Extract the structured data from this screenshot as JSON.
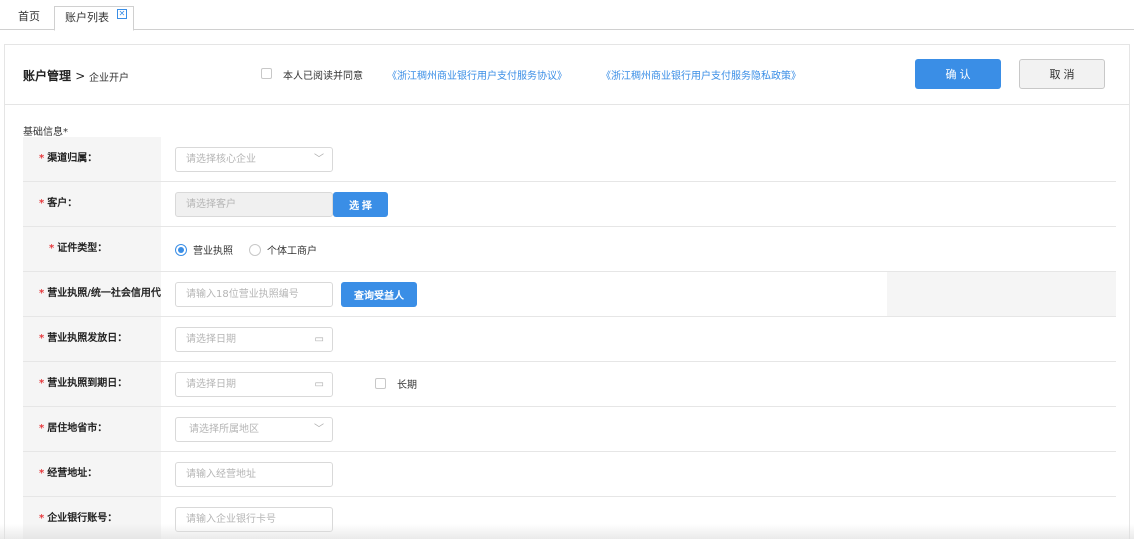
{
  "tabs": {
    "home": "首页",
    "active": "账户列表"
  },
  "header": {
    "crumb_main": "账户管理",
    "crumb_sep": ">",
    "crumb_sub": "企业开户",
    "agree_text": "本人已阅读并同意",
    "link1": "《浙江稠州商业银行用户支付服务协议》",
    "link2": "《浙江稠州商业银行用户支付服务隐私政策》",
    "confirm": "确 认",
    "cancel": "取 消"
  },
  "form": {
    "section_title": "基础信息*",
    "required_mark": "*",
    "rows": {
      "channel": {
        "label": "渠道归属：",
        "placeholder": "请选择核心企业"
      },
      "customer": {
        "label": "客户：",
        "placeholder": "请选择客户",
        "button": "选 择"
      },
      "cert_type": {
        "label": "证件类型：",
        "option1": "营业执照",
        "option2": "个体工商户"
      },
      "license_no": {
        "label": "营业执照/统一社会信用代码：",
        "placeholder": "请输入18位营业执照编号",
        "button": "查询受益人"
      },
      "issue_date": {
        "label": "营业执照发放日：",
        "placeholder": "请选择日期"
      },
      "expire_date": {
        "label": "营业执照到期日：",
        "placeholder": "请选择日期",
        "long_term": "长期"
      },
      "region": {
        "label": "居住地省市：",
        "placeholder": "请选择所属地区"
      },
      "address": {
        "label": "经营地址：",
        "placeholder": "请输入经营地址"
      },
      "bank_account": {
        "label": "企业银行账号：",
        "placeholder": "请输入企业银行卡号"
      }
    }
  },
  "colors": {
    "accent": "#3a8ee6",
    "required": "#e6393d",
    "label_bg": "#f5f5f5"
  },
  "icons": {
    "tab_close": "close-icon",
    "select_arrow": "chevron-down-icon",
    "date": "calendar-icon"
  }
}
